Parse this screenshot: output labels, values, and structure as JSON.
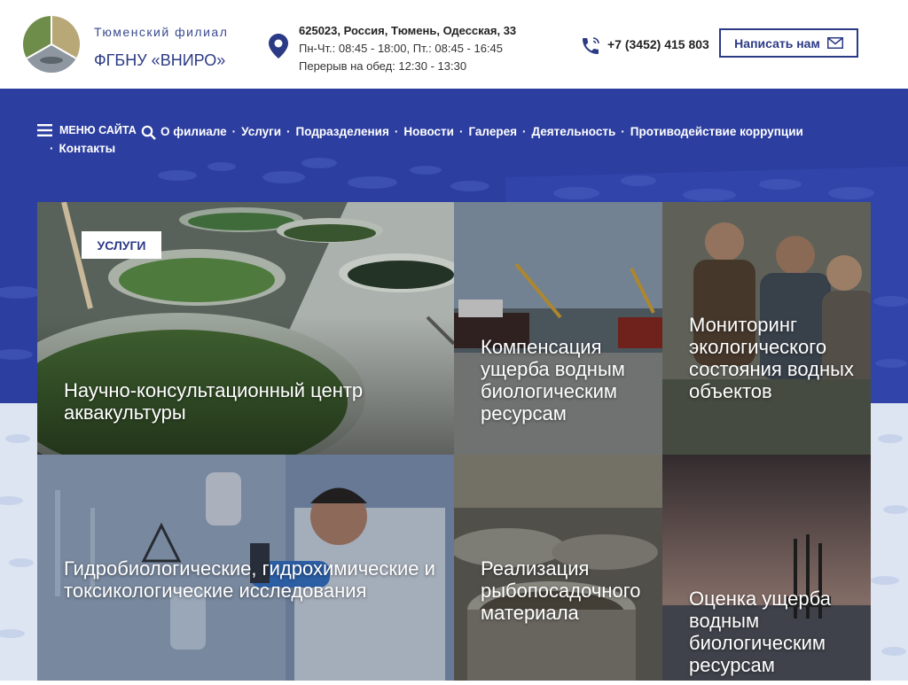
{
  "header": {
    "branch_label": "Тюменский филиал",
    "org_name": "ФГБНУ «ВНИРО»",
    "address": "625023, Россия, Тюмень, Одесская, 33",
    "hours": "Пн-Чт.: 08:45 - 18:00, Пт.: 08:45 - 16:45",
    "lunch": "Перерыв на обед: 12:30 - 13:30",
    "phone": "+7 (3452) 415 803",
    "write_button": "Написать нам"
  },
  "nav": {
    "menu_label": "МЕНЮ САЙТА",
    "items": [
      "О филиале",
      "Услуги",
      "Подразделения",
      "Новости",
      "Галерея",
      "Деятельность",
      "Противодействие коррупции",
      "Контакты"
    ]
  },
  "tiles": {
    "badge": "УСЛУГИ",
    "aquaculture": "Научно-консультационный центр аквакультуры",
    "compensation": "Компенсация ущерба водным биологическим ресурсам",
    "monitoring": "Мониторинг экологического состояния водных объектов",
    "research": "Гидробиологические, гидрохимические и токсикологические исследования",
    "fry": "Реализация рыбопосадочного материала",
    "assessment": "Оценка ущерба водным биологическим ресурсам"
  },
  "colors": {
    "brand": "#2b3a85",
    "hero_bg": "#2c3e9f"
  }
}
